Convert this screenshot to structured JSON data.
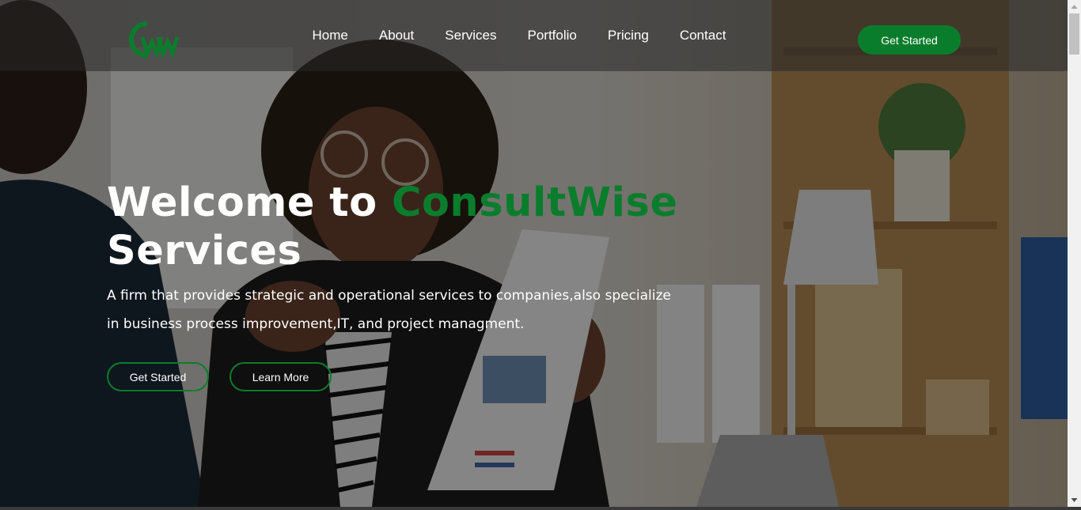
{
  "brand": {
    "logo_text": "CW"
  },
  "header": {
    "nav": [
      {
        "label": "Home"
      },
      {
        "label": "About"
      },
      {
        "label": "Services"
      },
      {
        "label": "Portfolio"
      },
      {
        "label": "Pricing"
      },
      {
        "label": "Contact"
      }
    ],
    "cta_label": "Get Started"
  },
  "hero": {
    "title_prefix": "Welcome to ",
    "title_brand": "ConsultWise",
    "title_suffix": "Services",
    "description": "A firm that provides strategic and operational services to companies,also specialize in business process improvement,IT, and project managment.",
    "primary_button": "Get Started",
    "secondary_button": "Learn More",
    "background_image": "office-meeting-photo"
  },
  "colors": {
    "accent": "#0a7d2c",
    "text": "#ffffff",
    "header_bg": "#282828"
  }
}
